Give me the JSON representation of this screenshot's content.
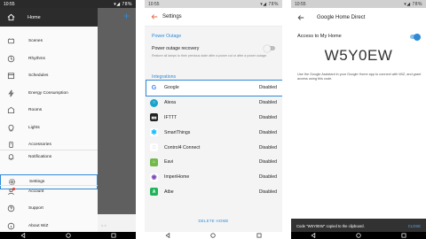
{
  "status_bar": {
    "time": "10:55",
    "indicators": "▾◢ 78%"
  },
  "panel1": {
    "drawer": {
      "home_label": "Home",
      "items": [
        {
          "label": "Scenes",
          "icon": "scenes-icon"
        },
        {
          "label": "Rhythms",
          "icon": "rhythms-icon"
        },
        {
          "label": "Schedules",
          "icon": "schedules-icon"
        },
        {
          "label": "Energy Consumption",
          "icon": "energy-icon"
        },
        {
          "label": "Rooms",
          "icon": "rooms-icon"
        },
        {
          "label": "Lights",
          "icon": "lights-icon"
        },
        {
          "label": "Accessories",
          "icon": "accessories-icon"
        },
        {
          "label": "Notifications",
          "icon": "bell-icon"
        },
        {
          "label": "Settings",
          "icon": "gear-icon"
        },
        {
          "label": "Account",
          "icon": "account-icon"
        },
        {
          "label": "Support",
          "icon": "support-icon"
        },
        {
          "label": "About WiZ",
          "icon": "info-icon"
        }
      ]
    },
    "background_plus": "+",
    "bottom_hint": "< >"
  },
  "panel2": {
    "title": "Settings",
    "power_outage": {
      "section": "Power Outage",
      "title": "Power outage recovery",
      "description": "Restore all lamps to their previous state after a power cut or after a power outage."
    },
    "integrations": {
      "section": "Integrations",
      "items": [
        {
          "name": "Google",
          "status": "Disabled",
          "color": "#ffffff"
        },
        {
          "name": "Alexa",
          "status": "Disabled",
          "color": "#1aa3c8"
        },
        {
          "name": "IFTTT",
          "status": "Disabled",
          "color": "#222222"
        },
        {
          "name": "SmartThings",
          "status": "Disabled",
          "color": "#15bfff"
        },
        {
          "name": "Control4 Connect",
          "status": "Disabled",
          "color": "#6a8fd3"
        },
        {
          "name": "Eavi",
          "status": "Disabled",
          "color": "#72b84a"
        },
        {
          "name": "ImperiHome",
          "status": "Disabled",
          "color": "#7a4ab8"
        },
        {
          "name": "Atbe",
          "status": "Disabled",
          "color": "#21b35a"
        }
      ]
    },
    "delete_home": "DELETE HOME"
  },
  "panel3": {
    "title": "Google Home Direct",
    "access_label": "Access to My Home",
    "code": "W5Y0EW",
    "description": "Use the Google Assistant in your Google Home app to connect with WiZ, and grant access using this code.",
    "snackbar": {
      "message": "Code \"W5Y0EW\" copied to the clipboard.",
      "action": "CLOSE"
    }
  },
  "colors": {
    "accent": "#2f8ad6"
  }
}
